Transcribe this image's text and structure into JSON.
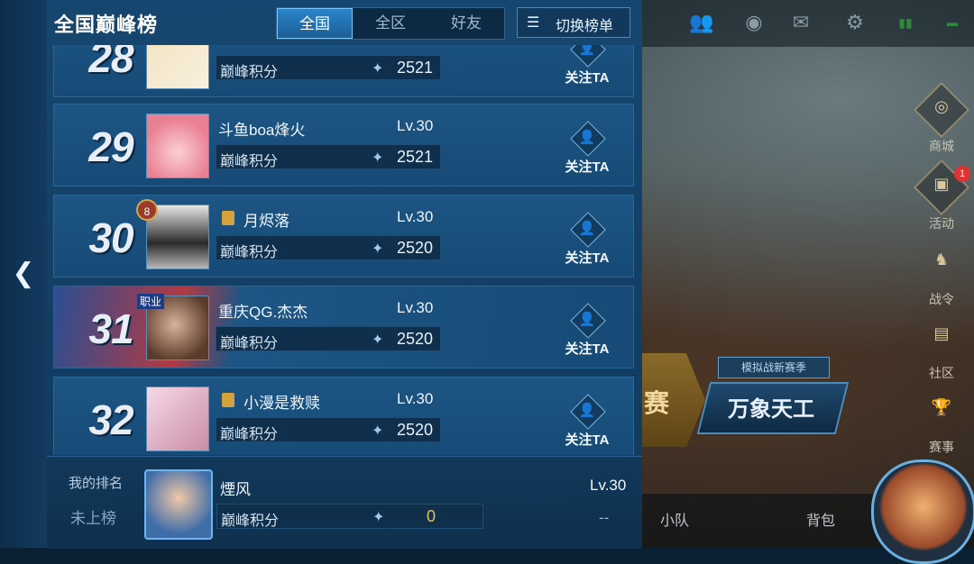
{
  "panel": {
    "title": "全国巅峰榜",
    "back_icon": "chevron-left-icon",
    "tabs": [
      {
        "label": "全国",
        "active": true
      },
      {
        "label": "全区",
        "active": false
      },
      {
        "label": "好友",
        "active": false
      }
    ],
    "switch_button": {
      "icon": "list-icon",
      "label": "切换榜单"
    }
  },
  "rows": [
    {
      "rank": "28",
      "name": "",
      "level": "",
      "score_label": "巅峰积分",
      "score": "2521",
      "follow": "关注TA",
      "medal": "",
      "pro_tag": ""
    },
    {
      "rank": "29",
      "name": "斗鱼boa烽火",
      "level": "Lv.30",
      "score_label": "巅峰积分",
      "score": "2521",
      "follow": "关注TA",
      "medal": "",
      "pro_tag": ""
    },
    {
      "rank": "30",
      "name": "月烬落",
      "level": "Lv.30",
      "score_label": "巅峰积分",
      "score": "2520",
      "follow": "关注TA",
      "medal": "8",
      "pro_tag": ""
    },
    {
      "rank": "31",
      "name": "重庆QG.杰杰",
      "level": "Lv.30",
      "score_label": "巅峰积分",
      "score": "2520",
      "follow": "关注TA",
      "medal": "",
      "pro_tag": "职业"
    },
    {
      "rank": "32",
      "name": "小漫是救赎",
      "level": "Lv.30",
      "score_label": "巅峰积分",
      "score": "2520",
      "follow": "关注TA",
      "medal": "",
      "pro_tag": ""
    }
  ],
  "my_rank": {
    "label": "我的排名",
    "status": "未上榜",
    "name": "煙风",
    "level": "Lv.30",
    "score_label": "巅峰积分",
    "score": "0",
    "dash": "--"
  },
  "background": {
    "side_menu": [
      {
        "label": "商城",
        "icon": "shop-icon"
      },
      {
        "label": "活动",
        "icon": "gift-icon",
        "badge": "1"
      },
      {
        "label": "战令",
        "icon": "horse-icon"
      },
      {
        "label": "社区",
        "icon": "community-icon"
      },
      {
        "label": "赛事",
        "icon": "trophy-icon"
      }
    ],
    "mode_banner_tag": "模拟战新赛季",
    "mode_banner_title": "万象天工",
    "partial_banner": "赛",
    "bottom_items": [
      "小队",
      "背包"
    ]
  },
  "colors": {
    "panel": "#16466f",
    "accent": "#2b84c8",
    "score_zero": "#e2c35a"
  }
}
